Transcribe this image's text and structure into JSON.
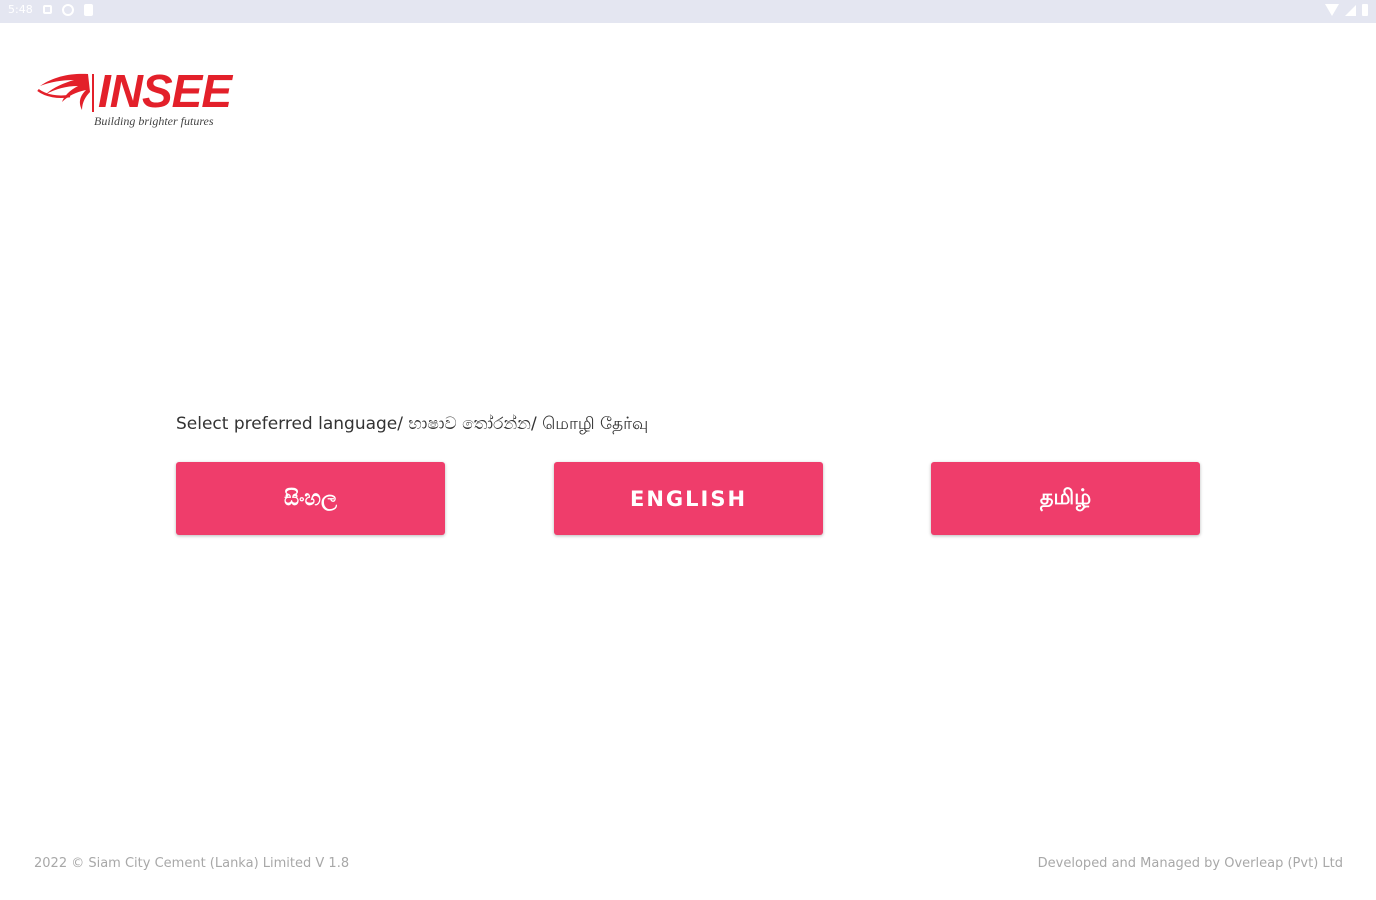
{
  "status_bar": {
    "time": "5:48",
    "left_icons": [
      "notification-square-icon",
      "sync-circle-icon",
      "sd-card-icon"
    ],
    "right_icons": [
      "wifi-icon",
      "signal-icon",
      "battery-icon"
    ]
  },
  "brand": {
    "name": "INSEE",
    "tagline": "Building brighter futures",
    "color": "#e3202a"
  },
  "language_select": {
    "prompt": "Select preferred language/ භාෂාව තෝරන්න/ மொழி தேர்வு",
    "buttons": {
      "sinhala": "සිංහල",
      "english": "ENGLISH",
      "tamil": "தமிழ்"
    },
    "button_color": "#ef3d6b"
  },
  "footer": {
    "copyright": "2022 © Siam City Cement (Lanka) Limited   V 1.8",
    "developer": "Developed and Managed by Overleap (Pvt) Ltd"
  }
}
